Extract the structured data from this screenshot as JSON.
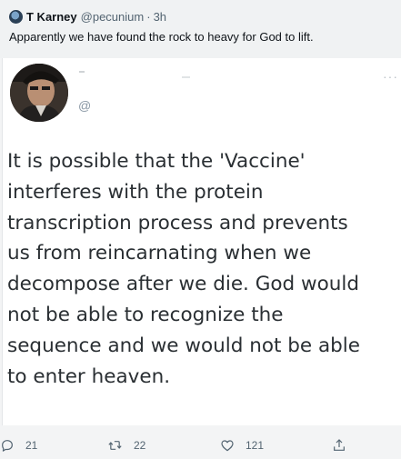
{
  "retweet_header": {
    "author_name": "T Karney",
    "author_handle": "@pecunium",
    "separator": "·",
    "time": "3h",
    "text": "Apparently we have found the rock to heavy for God to lift."
  },
  "embedded_post": {
    "name_text": "'",
    "dot_text": "·",
    "handle_text": "@",
    "more_label": "···",
    "body_lines": [
      "It is possible that the 'Vaccine'",
      "interferes with the protein",
      "transcription process and prevents",
      "us from reincarnating when we",
      "decompose after we die. God would",
      "not be able to recognize the",
      "sequence and we would not be able",
      "to enter heaven."
    ]
  },
  "actions": {
    "reply_count": "21",
    "retweet_count": "22",
    "like_count": "121"
  },
  "icons": {
    "reply": "reply-icon",
    "retweet": "retweet-icon",
    "like": "heart-icon",
    "share": "share-icon",
    "more": "more-icon"
  },
  "colors": {
    "header_background": "#f0f2f3",
    "panel_background": "#ffffff",
    "body_text": "#2a2f33",
    "muted_text": "#536471"
  }
}
